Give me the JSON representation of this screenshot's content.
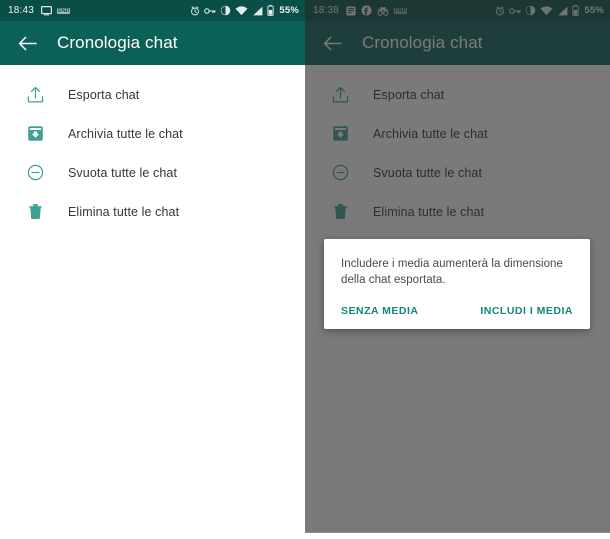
{
  "theme": {
    "statusbar_bg": "#0a4f47",
    "appbar_bg": "#0b6157",
    "accent_teal": "#13877a",
    "icon_teal": "#3fa094",
    "text_primary": "#2f3b39",
    "scrim": "rgba(40,40,40,0.62)"
  },
  "left_screen": {
    "statusbar": {
      "clock": "18:43",
      "left_icons": [
        "monitor-icon",
        "dnd-icon"
      ],
      "right_icons": [
        "alarm-icon",
        "key-icon",
        "vibrate-icon",
        "wifi-icon",
        "signal-icon",
        "battery-icon"
      ],
      "battery_label": "55%",
      "dnd_label": "DND"
    },
    "appbar": {
      "back_label": "back-arrow",
      "title": "Cronologia chat"
    },
    "menu": [
      {
        "icon": "export-icon",
        "label": "Esporta chat"
      },
      {
        "icon": "archive-icon",
        "label": "Archivia tutte le chat"
      },
      {
        "icon": "clear-icon",
        "label": "Svuota tutte le chat"
      },
      {
        "icon": "trash-icon",
        "label": "Elimina tutte le chat"
      }
    ]
  },
  "right_screen": {
    "statusbar": {
      "clock": "18:38",
      "left_icons": [
        "article-icon",
        "facebook-icon",
        "incognito-icon",
        "dnd-icon"
      ],
      "right_icons": [
        "alarm-icon",
        "key-icon",
        "vibrate-icon",
        "wifi-icon",
        "signal-icon",
        "battery-icon"
      ],
      "battery_label": "55%",
      "dnd_label": "DND"
    },
    "appbar": {
      "back_label": "back-arrow",
      "title": "Cronologia chat"
    },
    "menu": [
      {
        "icon": "export-icon",
        "label": "Esporta chat"
      },
      {
        "icon": "archive-icon",
        "label": "Archivia tutte le chat"
      },
      {
        "icon": "clear-icon",
        "label": "Svuota tutte le chat"
      },
      {
        "icon": "trash-icon",
        "label": "Elimina tutte le chat"
      }
    ],
    "dialog": {
      "message": "Includere i media aumenterà la dimensione della chat esportata.",
      "negative_label": "SENZA MEDIA",
      "positive_label": "INCLUDI I MEDIA"
    }
  }
}
